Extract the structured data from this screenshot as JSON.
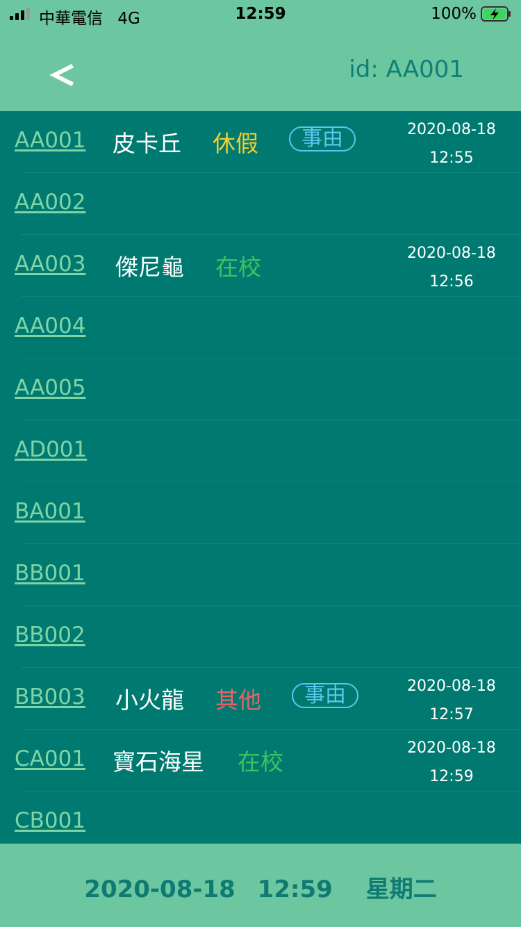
{
  "status_bar": {
    "carrier": "中華電信",
    "network": "4G",
    "time": "12:59",
    "battery": "100%"
  },
  "nav": {
    "back_label": "<",
    "id_label": "id: AA001"
  },
  "rows": [
    {
      "code": "AA001",
      "name": "皮卡丘",
      "status": "休假",
      "status_color": "#F2CC2E",
      "reason": "事由",
      "date": "2020-08-18",
      "time": "12:55"
    },
    {
      "code": "AA002"
    },
    {
      "code": "AA003",
      "name": "傑尼龜",
      "status": "在校",
      "status_color": "#3EC15F",
      "date": "2020-08-18",
      "time": "12:56"
    },
    {
      "code": "AA004"
    },
    {
      "code": "AA005"
    },
    {
      "code": "AD001"
    },
    {
      "code": "BA001"
    },
    {
      "code": "BB001"
    },
    {
      "code": "BB002"
    },
    {
      "code": "BB003",
      "name": "小火龍",
      "status": "其他",
      "status_color": "#E8636A",
      "reason": "事由",
      "date": "2020-08-18",
      "time": "12:57"
    },
    {
      "code": "CA001",
      "name": "寶石海星",
      "status": "在校",
      "status_color": "#3EC15F",
      "date": "2020-08-18",
      "time": "12:59"
    },
    {
      "code": "CB001"
    }
  ],
  "footer": {
    "date": "2020-08-18",
    "time": "12:59",
    "weekday": "星期二"
  },
  "colors": {
    "header_bg": "#6CC6A0",
    "list_bg": "#007A70",
    "code_link": "#7FD4A6",
    "reason_border": "#5BC6F0"
  }
}
